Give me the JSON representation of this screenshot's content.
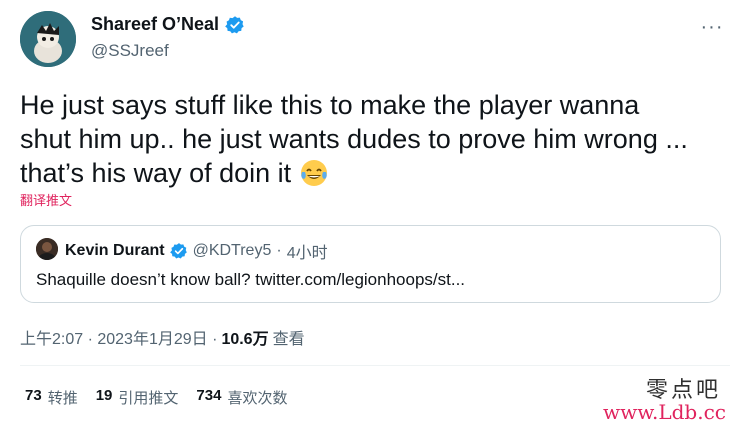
{
  "author": {
    "name": "Shareef O’Neal",
    "handle": "@SSJreef"
  },
  "tweet": {
    "text": "He just says stuff like this to make the player wanna\nshut him up.. he just wants dudes to prove him wrong ...\nthat’s his way of doin it ",
    "emoji_icon": "face-with-tears-of-joy",
    "translate_label": "翻译推文"
  },
  "quote": {
    "name": "Kevin Durant",
    "handle": "@KDTrey5",
    "separator": "·",
    "time": "4小时",
    "text": "Shaquille doesn’t know ball? twitter.com/legionhoops/st..."
  },
  "meta": {
    "timestamp": "上午2:07 · 2023年1月29日 ·",
    "views_count": "10.6万",
    "views_label": "查看"
  },
  "stats": {
    "retweets_count": "73",
    "retweets_label": "转推",
    "quotes_count": "19",
    "quotes_label": "引用推文",
    "likes_count": "734",
    "likes_label": "喜欢次数"
  },
  "watermark": {
    "site_name": "零点吧",
    "url": "www.Ldb.cc"
  },
  "colors": {
    "verified": "#1d9bf0",
    "translate": "#e0245e",
    "secondary_text": "#536471"
  }
}
